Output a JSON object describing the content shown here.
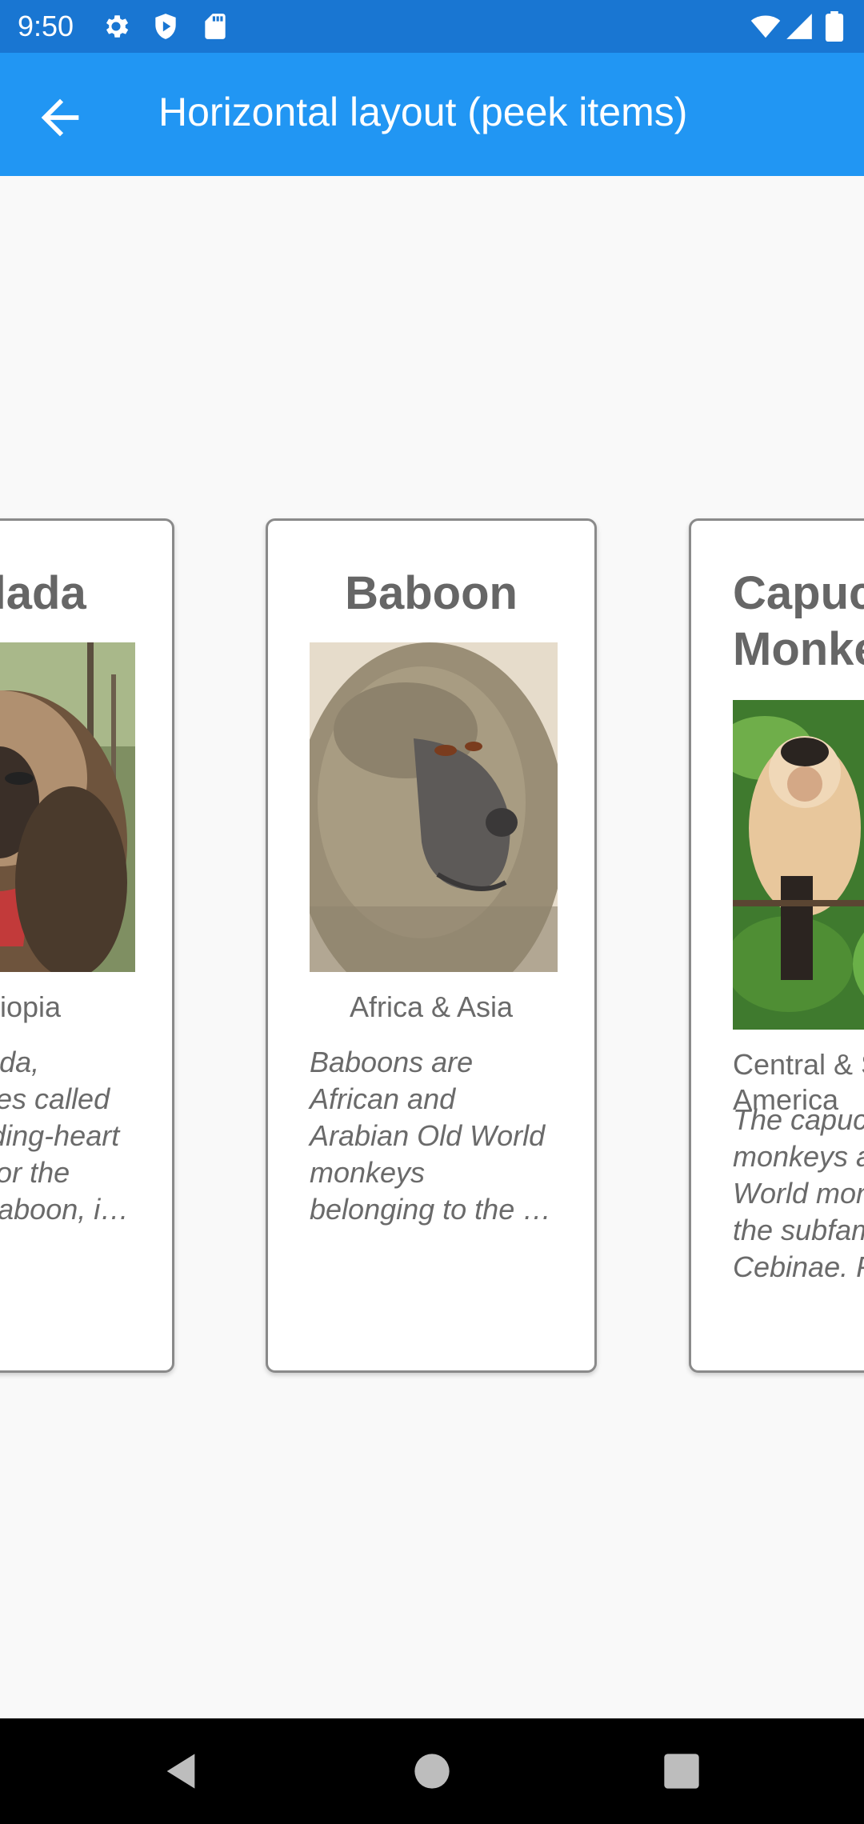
{
  "status_bar": {
    "time": "9:50",
    "left_icons": [
      "gear-icon",
      "shield-play-icon",
      "sd-card-icon"
    ],
    "right_icons": [
      "wifi-icon",
      "cell-signal-icon",
      "battery-icon"
    ]
  },
  "app_bar": {
    "back_icon": "arrow-back-icon",
    "title": "Horizontal layout (peek items)"
  },
  "cards": [
    {
      "title": "Gelada",
      "location": "Ethiopia",
      "description": "The gelada, sometimes called the bleeding-heart monkey or the gelada baboon, i…"
    },
    {
      "title": "Baboon",
      "location": "Africa & Asia",
      "description": "Baboons are African and Arabian Old World monkeys belonging to the …"
    },
    {
      "title": "Capuchin Monkey",
      "location": "Central & South America",
      "description": "The capuchin monkeys are New World monkeys of the subfamily Cebinae. P…"
    }
  ],
  "nav_bar": {
    "back_icon": "nav-back-icon",
    "home_icon": "nav-home-icon",
    "recents_icon": "nav-recents-icon"
  },
  "colors": {
    "status_bar": "#1976d2",
    "app_bar": "#2196f3",
    "background": "#f9f9f9",
    "card_border": "#8a8a8a",
    "text_gray": "#666666"
  }
}
